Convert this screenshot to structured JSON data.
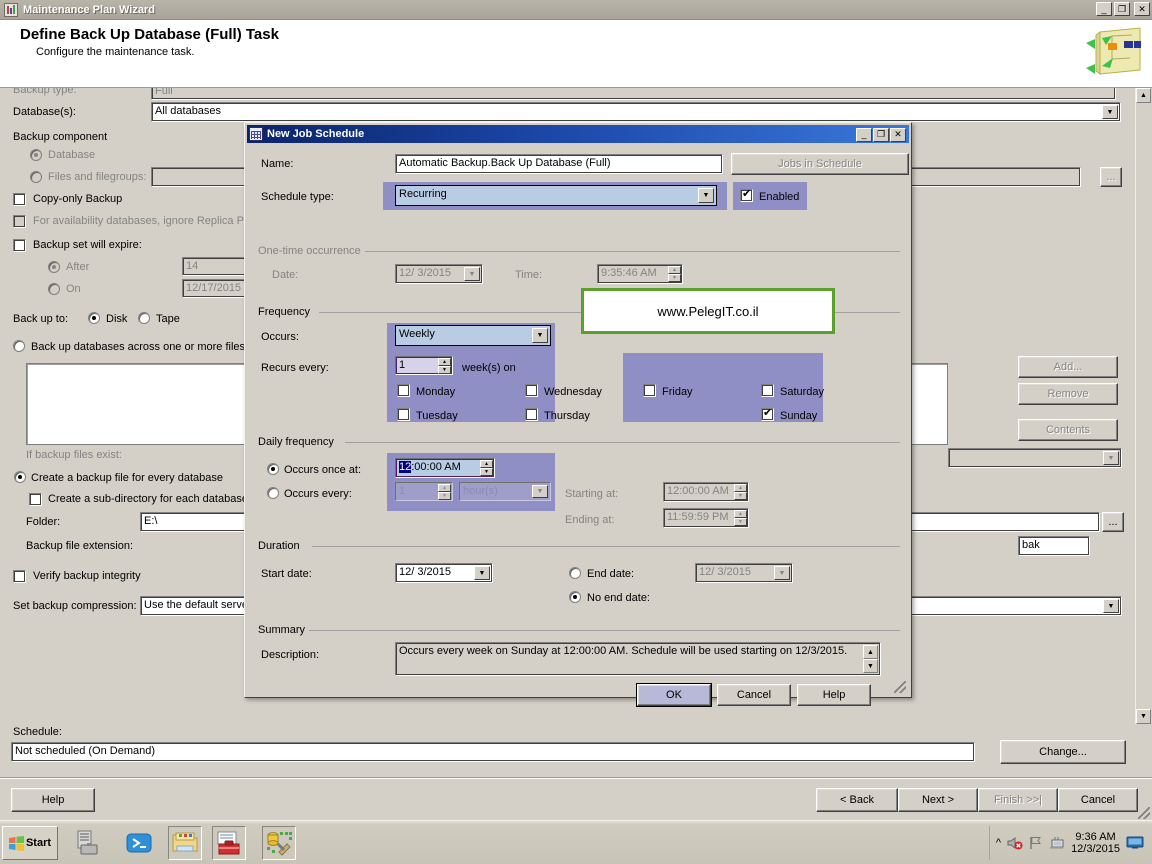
{
  "window": {
    "title": "Maintenance Plan Wizard",
    "minimize": "_",
    "maximize": "❐",
    "close": "✕"
  },
  "wizard_header": {
    "heading": "Define Back Up Database (Full) Task",
    "subheading": "Configure the maintenance task."
  },
  "background_page": {
    "backup_type_label": "Backup type:",
    "backup_type_value": "Full",
    "databases_label": "Database(s):",
    "databases_value": "All databases",
    "backup_component_label": "Backup component",
    "component_database": "Database",
    "component_files": "Files and filegroups:",
    "copy_only": "Copy-only Backup",
    "ignore_replica": "For availability databases, ignore Replica Priority",
    "backup_set_expire": "Backup set will expire:",
    "expire_after": "After",
    "expire_after_value": "14",
    "expire_on": "On",
    "expire_on_value": "12/17/2015",
    "backup_to_label": "Back up to:",
    "backup_to_disk": "Disk",
    "backup_to_tape": "Tape",
    "across_files": "Back up databases across one or more files:",
    "add_button": "Add...",
    "remove_button": "Remove",
    "contents_button": "Contents",
    "if_backup_files_exist": "If backup files exist:",
    "create_file_every_db": "Create a backup file for every database",
    "create_subdirectory": "Create a sub-directory for each database",
    "folder_label": "Folder:",
    "folder_value": "E:\\",
    "ext_label": "Backup file extension:",
    "ext_value": "bak",
    "verify_integrity": "Verify backup integrity",
    "compression_label": "Set backup compression:",
    "compression_value": "Use the default server setting",
    "ellipsis": "...",
    "schedule_label": "Schedule:",
    "schedule_value": "Not scheduled (On Demand)",
    "change_button": "Change..."
  },
  "wizard_footer": {
    "help": "Help",
    "back": "< Back",
    "next": "Next >",
    "finish": "Finish >>|",
    "cancel": "Cancel"
  },
  "dialog": {
    "title": "New Job Schedule",
    "minimize": "_",
    "maximize": "❐",
    "close": "✕",
    "name_label": "Name:",
    "name_value": "Automatic Backup.Back Up Database (Full)",
    "jobs_in_schedule_button": "Jobs in Schedule",
    "schedule_type_label": "Schedule type:",
    "schedule_type_value": "Recurring",
    "enabled_label": "Enabled",
    "one_time": {
      "group_label": "One-time occurrence",
      "date_label": "Date:",
      "date_value": "12/ 3/2015",
      "time_label": "Time:",
      "time_value": "9:35:46 AM"
    },
    "frequency": {
      "group_label": "Frequency",
      "occurs_label": "Occurs:",
      "occurs_value": "Weekly",
      "recurs_label": "Recurs every:",
      "recurs_value": "1",
      "recurs_unit": "week(s) on",
      "days": [
        {
          "label": "Monday",
          "checked": false
        },
        {
          "label": "Tuesday",
          "checked": false
        },
        {
          "label": "Wednesday",
          "checked": false
        },
        {
          "label": "Thursday",
          "checked": false
        },
        {
          "label": "Friday",
          "checked": false
        },
        {
          "label": "Saturday",
          "checked": false
        },
        {
          "label": "Sunday",
          "checked": true
        }
      ]
    },
    "daily": {
      "group_label": "Daily frequency",
      "once_at_label": "Occurs once at:",
      "once_at_value_sel": "12",
      "once_at_value_rest": ":00:00 AM",
      "every_label": "Occurs every:",
      "every_value": "1",
      "every_unit": "hour(s)",
      "starting_label": "Starting at:",
      "starting_value": "12:00:00 AM",
      "ending_label": "Ending at:",
      "ending_value": "11:59:59 PM"
    },
    "duration": {
      "group_label": "Duration",
      "start_date_label": "Start date:",
      "start_date_value": "12/ 3/2015",
      "end_date_label": "End date:",
      "end_date_value": "12/ 3/2015",
      "no_end_date_label": "No end date:"
    },
    "summary": {
      "group_label": "Summary",
      "description_label": "Description:",
      "description_value": "Occurs every week on Sunday at 12:00:00 AM. Schedule will be used starting on 12/3/2015."
    },
    "ok_button": "OK",
    "cancel_button": "Cancel",
    "help_button": "Help"
  },
  "watermark": {
    "text": "www.PelegIT.co.il",
    "border_color": "#5aa02c"
  },
  "taskbar": {
    "start_label": "Start",
    "clock_time": "9:36 AM",
    "clock_date": "12/3/2015"
  },
  "colors": {
    "dialog_title_start": "#0a246a",
    "dialog_title_end": "#3a78d8",
    "highlight_purple": "#8f8fc6",
    "combo_selected": "#b8cce4",
    "window_face": "#d4d0c8"
  }
}
